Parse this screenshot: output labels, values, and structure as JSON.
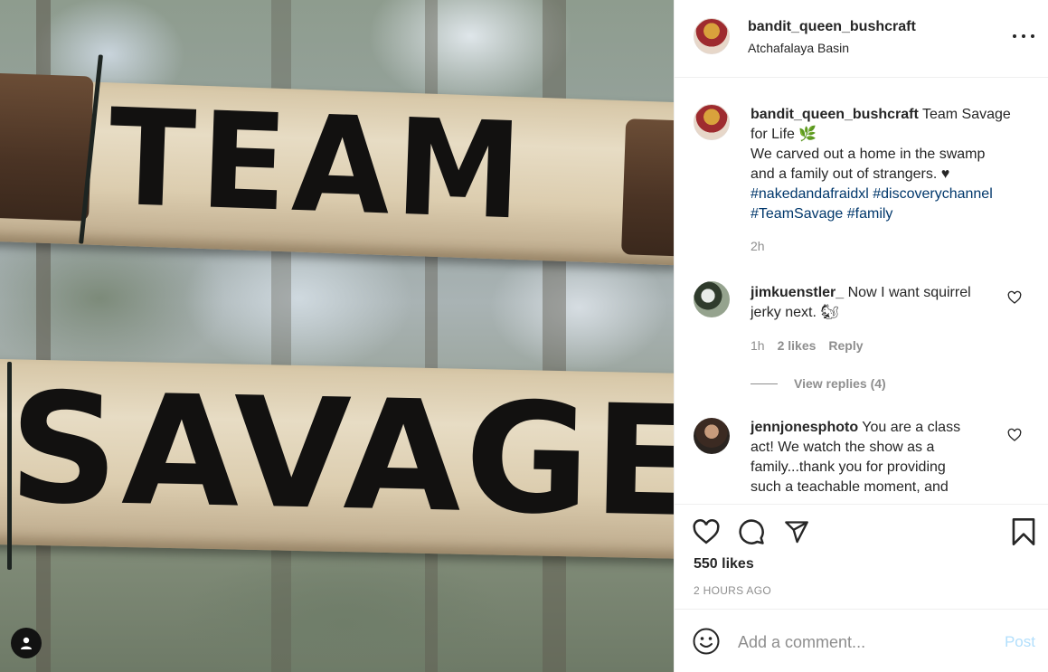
{
  "post": {
    "image_text": {
      "top_log": "TEAM",
      "bottom_log": "SAVAGE"
    }
  },
  "header": {
    "username": "bandit_queen_bushcraft",
    "location": "Atchafalaya Basin"
  },
  "caption": {
    "username": "bandit_queen_bushcraft",
    "text_line1": "Team Savage for Life",
    "emoji": "🌿",
    "text_line2": "We carved out a home in the swamp and a family out of strangers. ♥",
    "hashtags": [
      "#nakedandafraidxl",
      "#discoverychannel",
      "#TeamSavage",
      "#family"
    ],
    "time": "2h"
  },
  "comments": [
    {
      "username": "jimkuenstler_",
      "text": "Now I want squirrel jerky next. 🐿",
      "time": "1h",
      "likes": "2 likes",
      "reply_label": "Reply",
      "view_replies": "View replies (4)"
    },
    {
      "username": "jennjonesphoto",
      "text": "You are a class act! We watch the show as a family...thank you for providing such a teachable moment, and"
    }
  ],
  "actions": {
    "likes": "550 likes",
    "time_ago": "2 HOURS AGO"
  },
  "add_comment": {
    "placeholder": "Add a comment...",
    "post_label": "Post"
  },
  "colors": {
    "hashtag": "#00376b",
    "muted": "#8e8e8e",
    "post_disabled": "#b2dffc"
  }
}
